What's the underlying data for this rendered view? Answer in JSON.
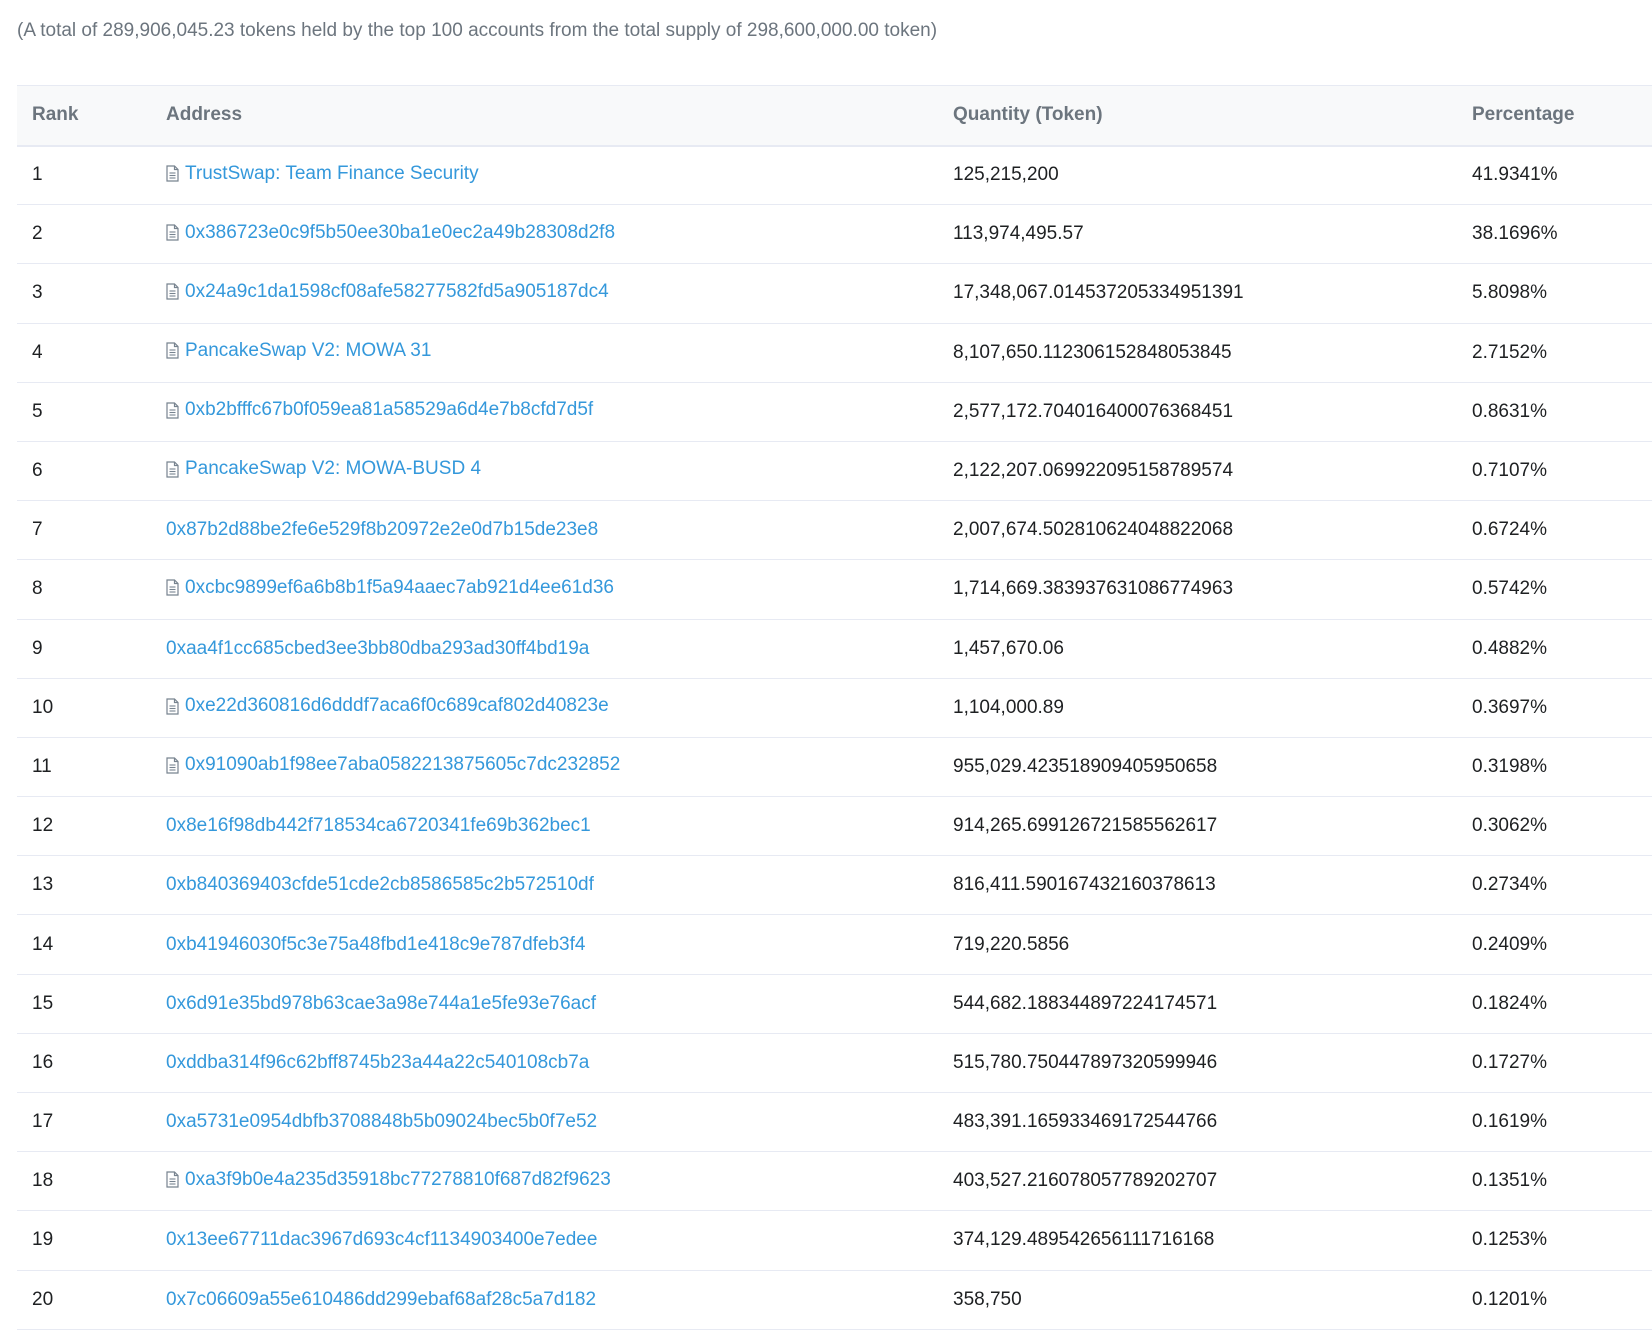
{
  "summary": "(A total of 289,906,045.23 tokens held by the top 100 accounts from the total supply of 298,600,000.00 token)",
  "columns": {
    "rank": "Rank",
    "address": "Address",
    "quantity": "Quantity (Token)",
    "percentage": "Percentage"
  },
  "rows": [
    {
      "rank": "1",
      "address": "TrustSwap: Team Finance Security",
      "contract_icon": "document-icon",
      "quantity": "125,215,200",
      "percentage": "41.9341%"
    },
    {
      "rank": "2",
      "address": "0x386723e0c9f5b50ee30ba1e0ec2a49b28308d2f8",
      "contract_icon": "document-icon",
      "quantity": "113,974,495.57",
      "percentage": "38.1696%"
    },
    {
      "rank": "3",
      "address": "0x24a9c1da1598cf08afe58277582fd5a905187dc4",
      "contract_icon": "document-icon",
      "quantity": "17,348,067.014537205334951391",
      "percentage": "5.8098%"
    },
    {
      "rank": "4",
      "address": "PancakeSwap V2: MOWA 31",
      "contract_icon": "document-icon",
      "quantity": "8,107,650.112306152848053845",
      "percentage": "2.7152%"
    },
    {
      "rank": "5",
      "address": "0xb2bfffc67b0f059ea81a58529a6d4e7b8cfd7d5f",
      "contract_icon": "document-icon",
      "quantity": "2,577,172.704016400076368451",
      "percentage": "0.8631%"
    },
    {
      "rank": "6",
      "address": "PancakeSwap V2: MOWA-BUSD 4",
      "contract_icon": "document-icon",
      "quantity": "2,122,207.069922095158789574",
      "percentage": "0.7107%"
    },
    {
      "rank": "7",
      "address": "0x87b2d88be2fe6e529f8b20972e2e0d7b15de23e8",
      "contract_icon": "",
      "quantity": "2,007,674.502810624048822068",
      "percentage": "0.6724%"
    },
    {
      "rank": "8",
      "address": "0xcbc9899ef6a6b8b1f5a94aaec7ab921d4ee61d36",
      "contract_icon": "document-icon",
      "quantity": "1,714,669.383937631086774963",
      "percentage": "0.5742%"
    },
    {
      "rank": "9",
      "address": "0xaa4f1cc685cbed3ee3bb80dba293ad30ff4bd19a",
      "contract_icon": "",
      "quantity": "1,457,670.06",
      "percentage": "0.4882%"
    },
    {
      "rank": "10",
      "address": "0xe22d360816d6dddf7aca6f0c689caf802d40823e",
      "contract_icon": "document-icon",
      "quantity": "1,104,000.89",
      "percentage": "0.3697%"
    },
    {
      "rank": "11",
      "address": "0x91090ab1f98ee7aba0582213875605c7dc232852",
      "contract_icon": "document-icon",
      "quantity": "955,029.423518909405950658",
      "percentage": "0.3198%"
    },
    {
      "rank": "12",
      "address": "0x8e16f98db442f718534ca6720341fe69b362bec1",
      "contract_icon": "",
      "quantity": "914,265.699126721585562617",
      "percentage": "0.3062%"
    },
    {
      "rank": "13",
      "address": "0xb840369403cfde51cde2cb8586585c2b572510df",
      "contract_icon": "",
      "quantity": "816,411.590167432160378613",
      "percentage": "0.2734%"
    },
    {
      "rank": "14",
      "address": "0xb41946030f5c3e75a48fbd1e418c9e787dfeb3f4",
      "contract_icon": "",
      "quantity": "719,220.5856",
      "percentage": "0.2409%"
    },
    {
      "rank": "15",
      "address": "0x6d91e35bd978b63cae3a98e744a1e5fe93e76acf",
      "contract_icon": "",
      "quantity": "544,682.188344897224174571",
      "percentage": "0.1824%"
    },
    {
      "rank": "16",
      "address": "0xddba314f96c62bff8745b23a44a22c540108cb7a",
      "contract_icon": "",
      "quantity": "515,780.750447897320599946",
      "percentage": "0.1727%"
    },
    {
      "rank": "17",
      "address": "0xa5731e0954dbfb3708848b5b09024bec5b0f7e52",
      "contract_icon": "",
      "quantity": "483,391.165933469172544766",
      "percentage": "0.1619%"
    },
    {
      "rank": "18",
      "address": "0xa3f9b0e4a235d35918bc77278810f687d82f9623",
      "contract_icon": "document-icon",
      "quantity": "403,527.216078057789202707",
      "percentage": "0.1351%"
    },
    {
      "rank": "19",
      "address": "0x13ee67711dac3967d693c4cf1134903400e7edee",
      "contract_icon": "",
      "quantity": "374,129.489542656111716168",
      "percentage": "0.1253%"
    },
    {
      "rank": "20",
      "address": "0x7c06609a55e610486dd299ebaf68af28c5a7d182",
      "contract_icon": "",
      "quantity": "358,750",
      "percentage": "0.1201%"
    }
  ],
  "colors": {
    "link": "#3498db",
    "muted_text": "#6c757e",
    "header_bg": "#f8f9fa",
    "border": "#e7eaf3"
  }
}
